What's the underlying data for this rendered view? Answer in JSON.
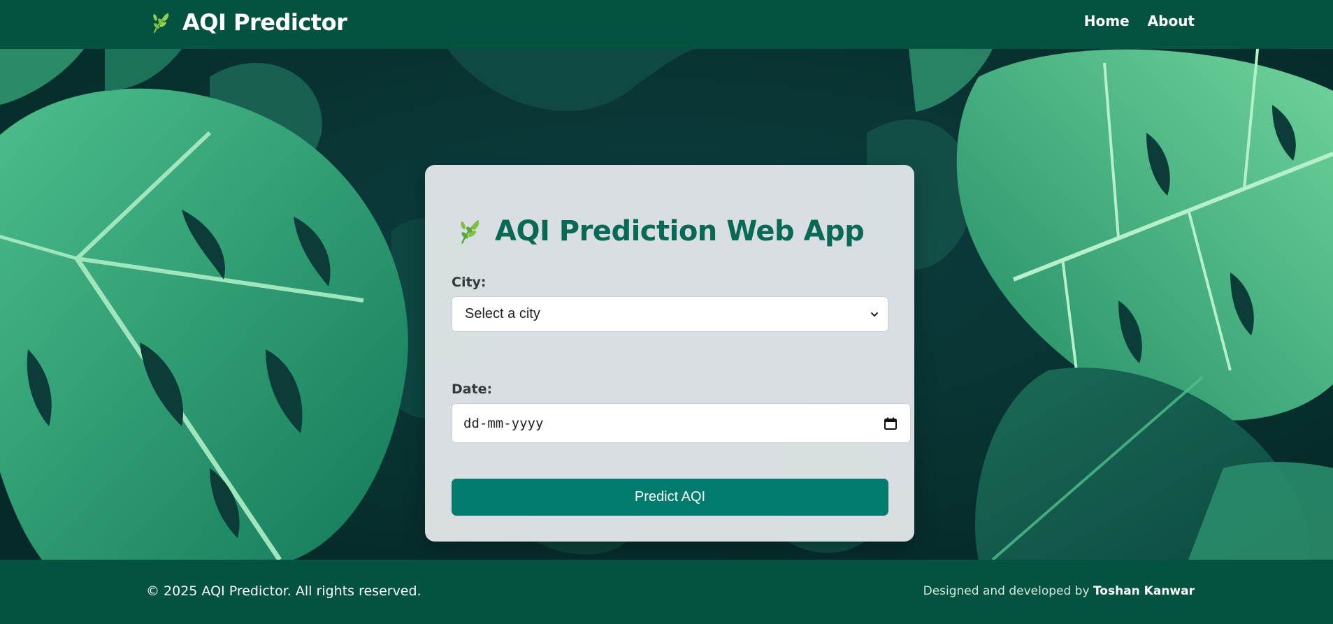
{
  "navbar": {
    "brand_icon": "leaf-sprig-icon",
    "brand_text": "AQI Predictor",
    "links": [
      {
        "label": "Home"
      },
      {
        "label": "About"
      }
    ]
  },
  "card": {
    "title_icon": "leaf-sprig-icon",
    "title": "AQI Prediction Web App",
    "city_label": "City:",
    "city_select_value": "Select a city",
    "date_label": "Date:",
    "date_placeholder": "dd-mm-yyyy",
    "predict_label": "Predict AQI"
  },
  "footer": {
    "copyright": "© 2025 AQI Predictor. All rights reserved.",
    "credit_prefix": "Designed and developed by ",
    "credit_author": "Toshan Kanwar"
  },
  "colors": {
    "navbar": "#045340",
    "footer": "#045340",
    "accent": "#017b6d",
    "title": "#086955",
    "card": "#e1e5e8"
  }
}
